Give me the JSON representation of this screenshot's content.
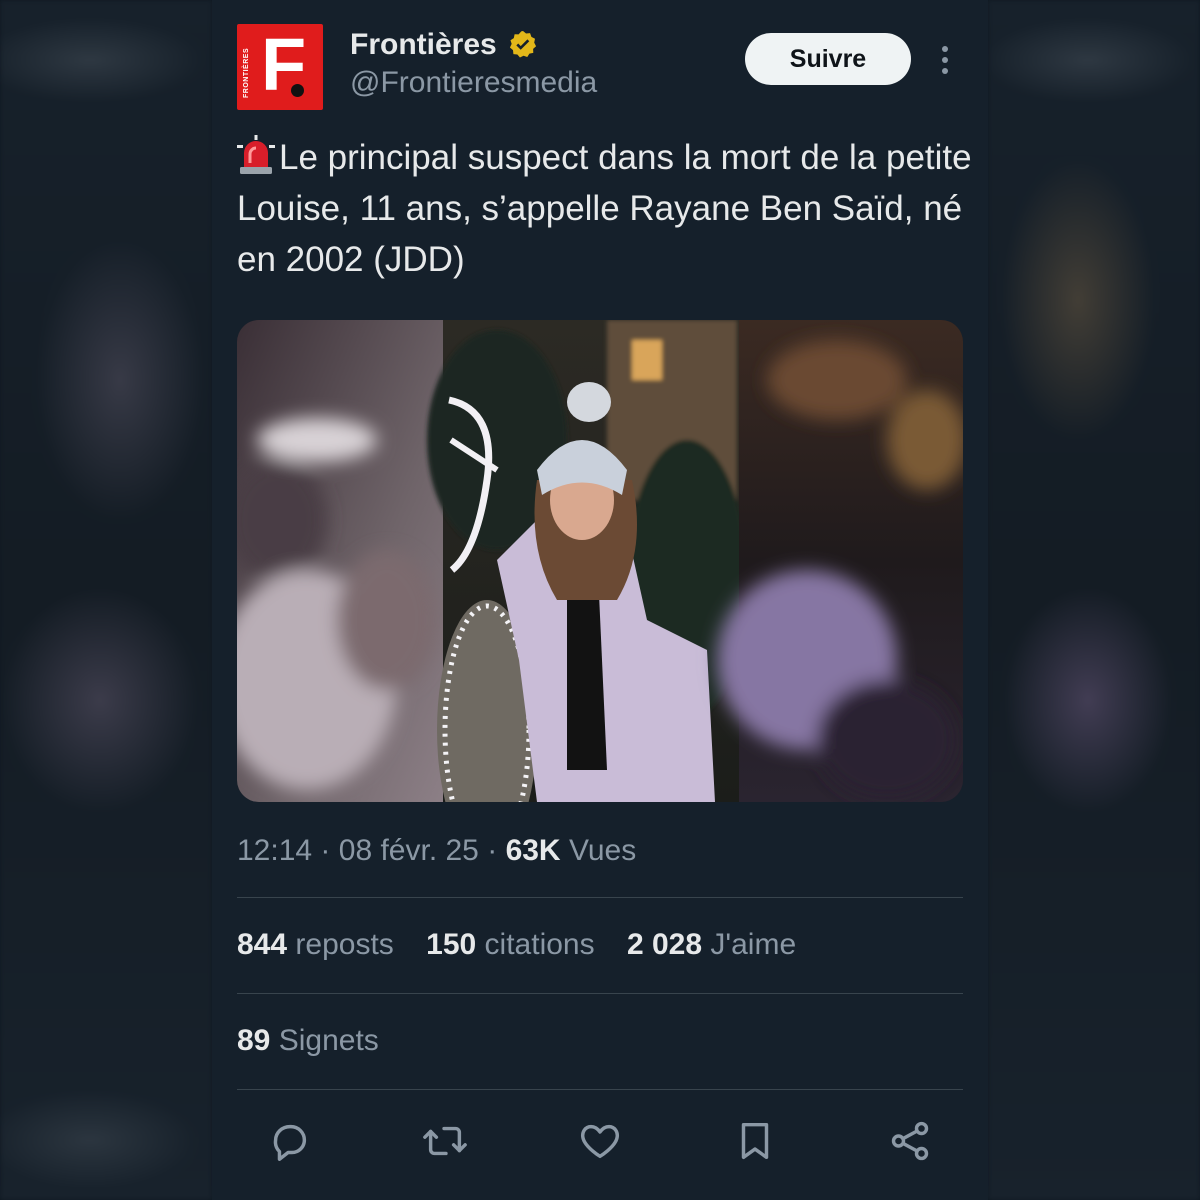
{
  "account": {
    "display_name": "Frontières",
    "handle": "@Frontieresmedia",
    "avatar_letter": "F.",
    "avatar_wordmark": "FRONTIÈRES",
    "verified_color": "#e2b719",
    "brand_color": "#e01c1c"
  },
  "header": {
    "follow_label": "Suivre",
    "more_icon": "more-vertical-icon"
  },
  "tweet": {
    "emoji_icon": "police-light-icon",
    "text": "Le principal suspect dans la mort de la petite Louise, 11 ans, s’appelle Rayane Ben Saïd, né en 2002 (JDD)",
    "media_description_icon": "photo"
  },
  "meta": {
    "time": "12:14",
    "date": "08 févr. 25",
    "separator": "·",
    "views_count": "63K",
    "views_label": "Vues"
  },
  "stats": {
    "reposts_count": "844",
    "reposts_label": "reposts",
    "quotes_count": "150",
    "quotes_label": "citations",
    "likes_count": "2 028",
    "likes_label": "J'aime",
    "bookmarks_count": "89",
    "bookmarks_label": "Signets"
  },
  "actions": [
    {
      "icon": "reply-icon"
    },
    {
      "icon": "repost-icon"
    },
    {
      "icon": "like-icon"
    },
    {
      "icon": "bookmark-icon"
    },
    {
      "icon": "share-icon"
    }
  ],
  "colors": {
    "background": "#15202b",
    "text_primary": "#e7e9ea",
    "text_secondary": "#8b98a5",
    "divider": "#38444d",
    "button_bg": "#eff3f4"
  }
}
